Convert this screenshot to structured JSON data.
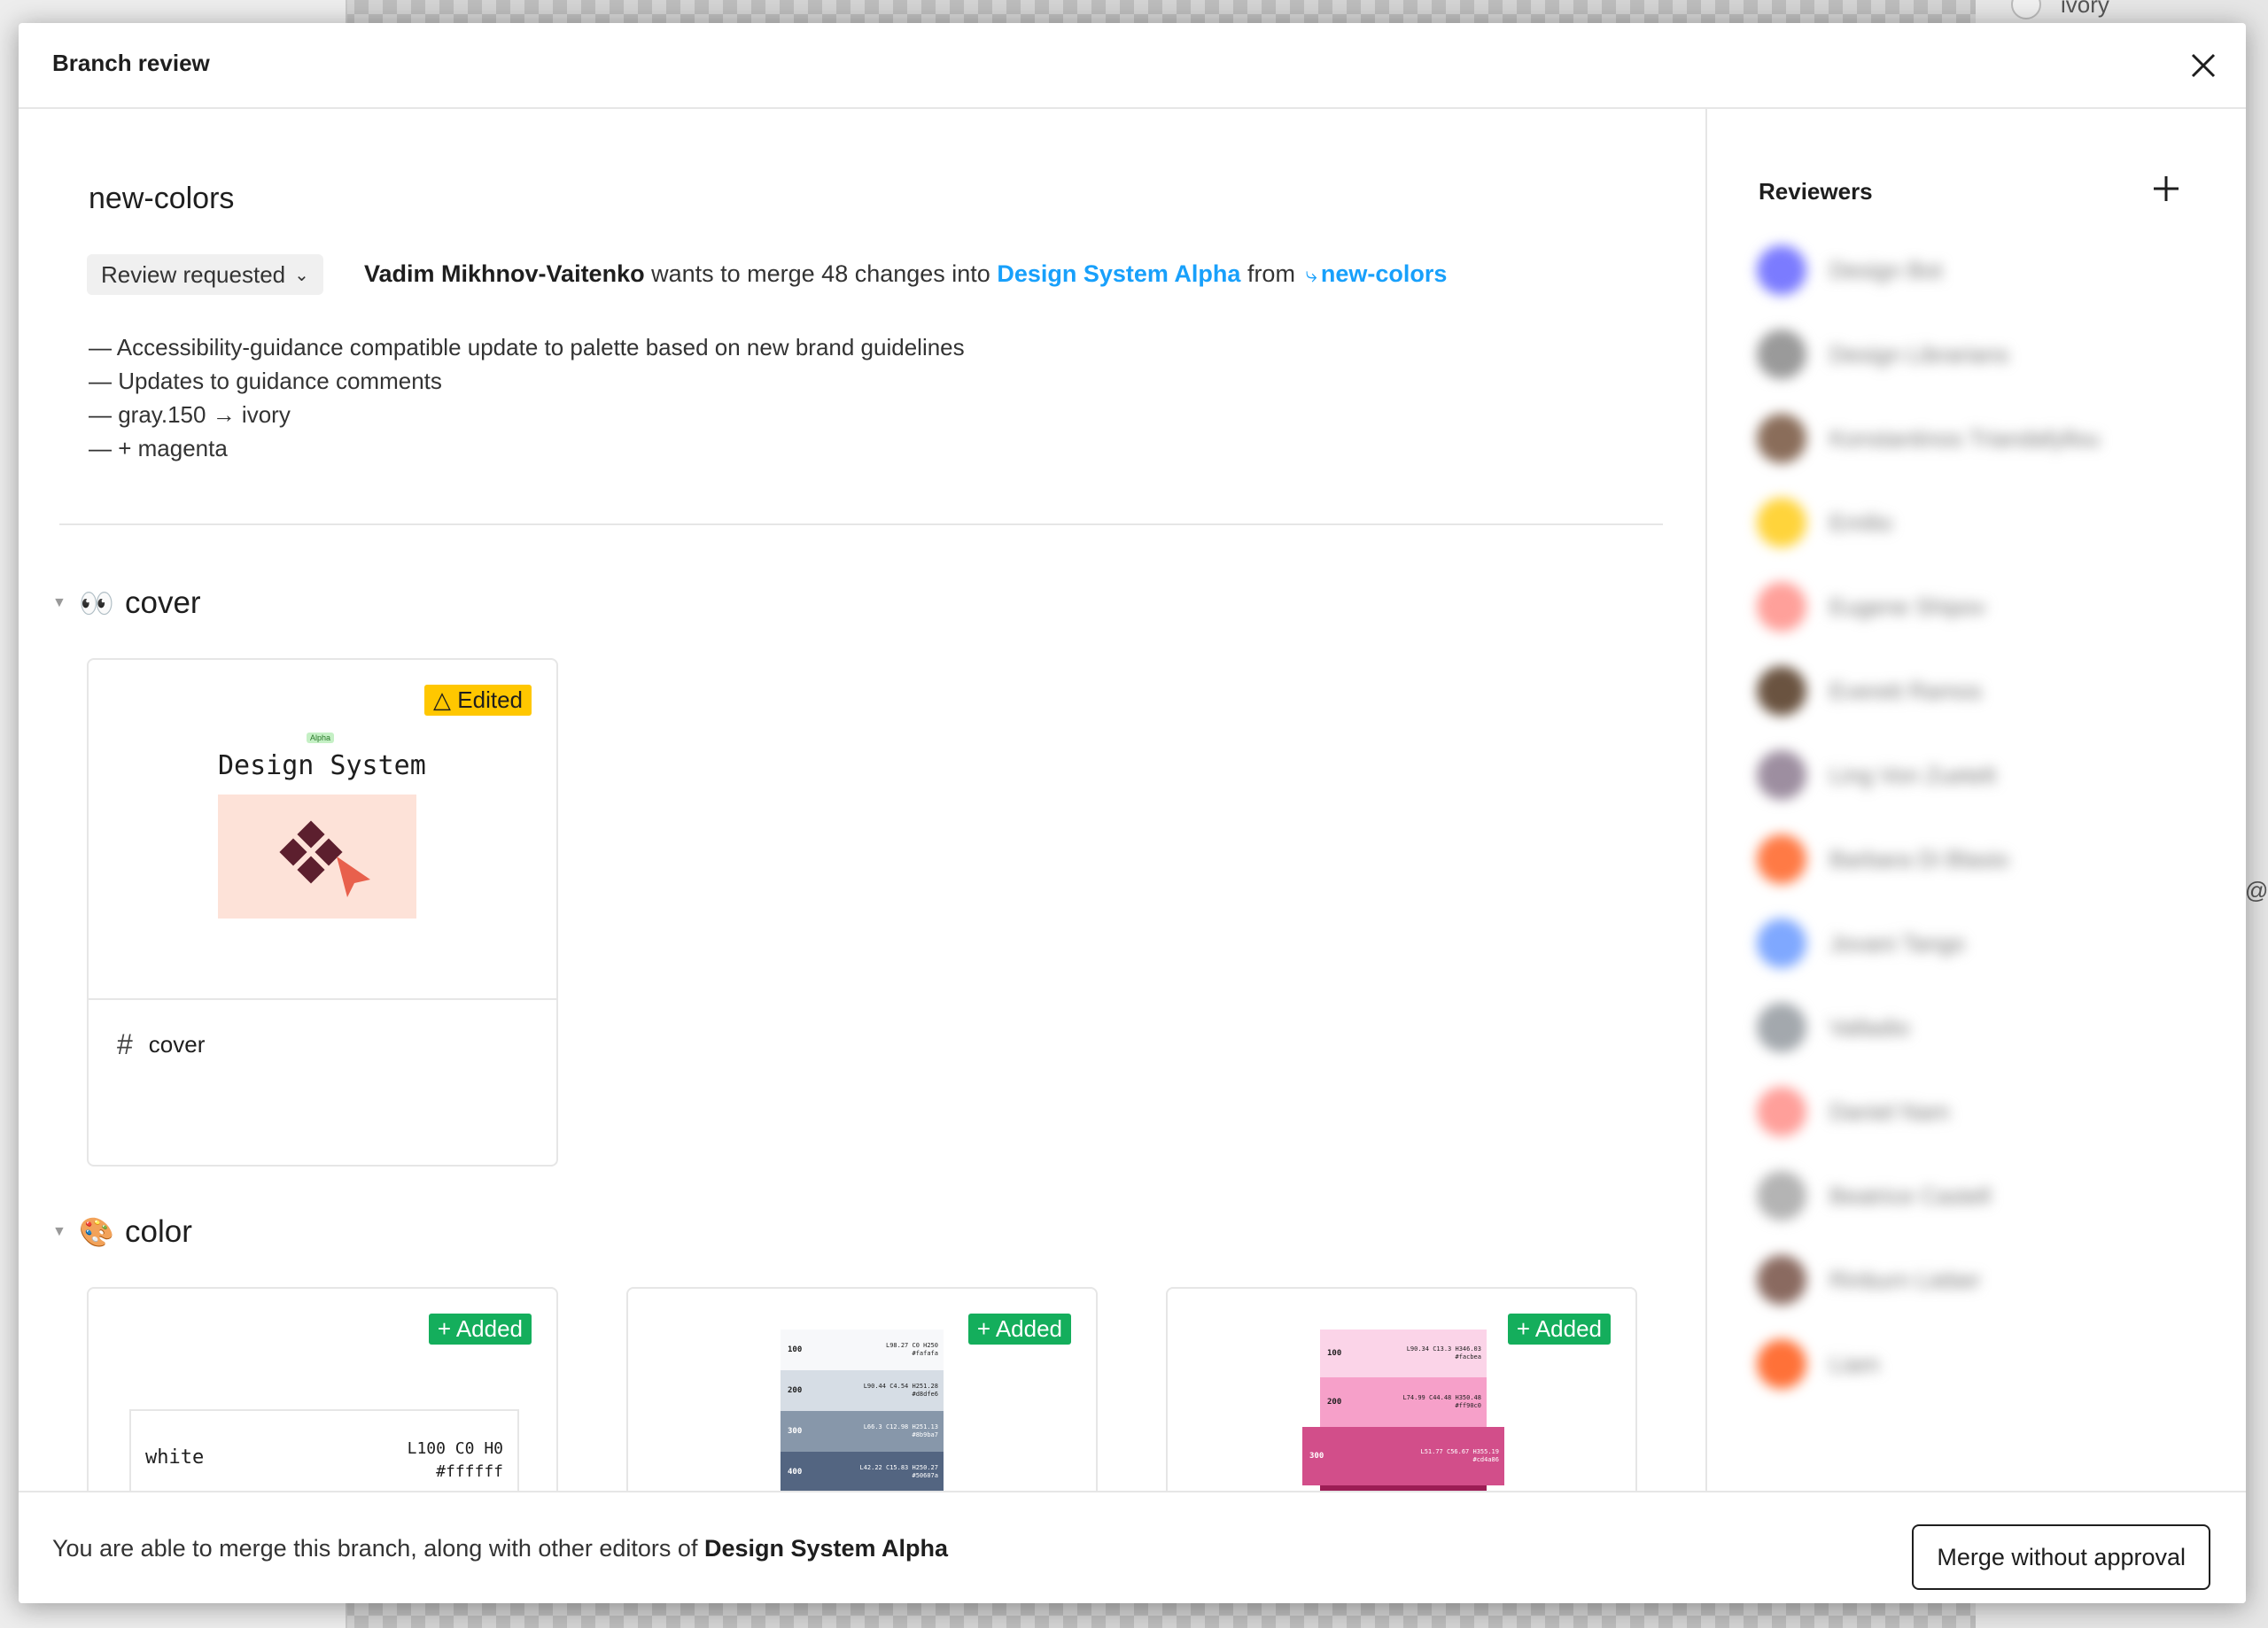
{
  "modal": {
    "title": "Branch review"
  },
  "branch": {
    "name": "new-colors",
    "status": "Review requested",
    "author": "Vadim Mikhnov-Vaitenko",
    "merge_text": "wants to merge 48 changes into",
    "target_file": "Design System Alpha",
    "from_text": "from",
    "source_branch": "new-colors",
    "description": [
      "— Accessibility-guidance compatible update to palette based on new brand guidelines",
      "— Updates to guidance comments",
      "— gray.150 → ivory",
      "— + magenta"
    ]
  },
  "sections": {
    "cover": {
      "emoji": "👀",
      "title": "cover",
      "card": {
        "badge": "△ Edited",
        "thumb_title": "Design System",
        "thumb_tag": "Alpha",
        "frame_name": "cover"
      }
    },
    "color": {
      "emoji": "🎨",
      "title": "color",
      "cards": [
        {
          "badge": "+ Added",
          "swatch_name": "white",
          "swatch_line1": "L100 C0 H0",
          "swatch_line2": "#ffffff"
        },
        {
          "badge": "+ Added",
          "rows": [
            {
              "key": "100",
              "v1": "L98.27 C0 H250",
              "v2": "#fafafa",
              "color": "#f7f8fa"
            },
            {
              "key": "200",
              "v1": "L90.44 C4.54 H251.28",
              "v2": "#d8dfe6",
              "color": "#d6dde5"
            },
            {
              "key": "300",
              "v1": "L66.3 C12.98 H251.13",
              "v2": "#8b9ba7",
              "color": "#8797aa"
            },
            {
              "key": "400",
              "v1": "L42.22 C15.83 H250.27",
              "v2": "#50607a",
              "color": "#536581"
            }
          ]
        },
        {
          "badge": "+ Added",
          "rows": [
            {
              "key": "100",
              "v1": "L90.34 C13.3 H346.03",
              "v2": "#facbea",
              "color": "#fbd4e8"
            },
            {
              "key": "200",
              "v1": "L74.99 C44.48 H350.48",
              "v2": "#ff90c0",
              "color": "#f6a0c9"
            },
            {
              "key": "300",
              "v1": "L51.77 C56.67 H355.19",
              "v2": "#cd4a86",
              "color": "#d24e8a"
            }
          ]
        }
      ]
    }
  },
  "reviewers": {
    "title": "Reviewers",
    "list": [
      {
        "name": "Design Bot",
        "color": "#7b7bff"
      },
      {
        "name": "Design Librarians",
        "color": "#9a9a9a"
      },
      {
        "name": "Konstantinos Triandafyllou",
        "color": "#8a6d5a"
      },
      {
        "name": "Emilio",
        "color": "#ffd43b"
      },
      {
        "name": "Eugene Shipov",
        "color": "#ffa09a"
      },
      {
        "name": "Everett Ramos",
        "color": "#6a5340"
      },
      {
        "name": "Ling Von Zuetelt",
        "color": "#9d8ea0"
      },
      {
        "name": "Barbara Di Blasio",
        "color": "#ff7a45"
      },
      {
        "name": "Jovani Tango",
        "color": "#7fa8ff"
      },
      {
        "name": "Valladio",
        "color": "#a3a8ad"
      },
      {
        "name": "Daniel Nam",
        "color": "#ff9f9a"
      },
      {
        "name": "Beatrice Castell",
        "color": "#b4b4b4"
      },
      {
        "name": "Rinburn Lieber",
        "color": "#8a6a60"
      },
      {
        "name": "Liam",
        "color": "#ff7138"
      }
    ]
  },
  "footer": {
    "text_prefix": "You are able to merge this branch, along with other editors of",
    "file": "Design System Alpha",
    "button": "Merge without approval"
  },
  "background": {
    "peek_right": "ivory",
    "peek_at": "@c"
  }
}
